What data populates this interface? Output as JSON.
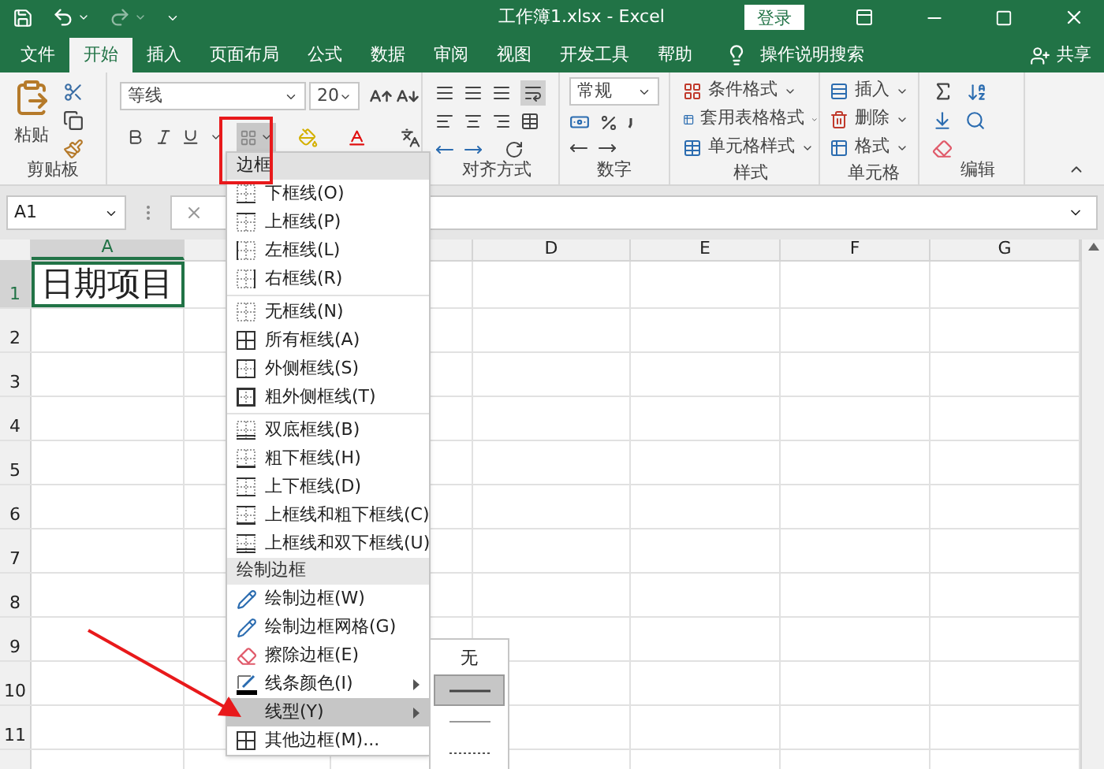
{
  "window": {
    "title": "工作簿1.xlsx - Excel",
    "login_button": "登录"
  },
  "ribbon_tabs": [
    {
      "label": "文件",
      "selected": false
    },
    {
      "label": "开始",
      "selected": true
    },
    {
      "label": "插入",
      "selected": false
    },
    {
      "label": "页面布局",
      "selected": false
    },
    {
      "label": "公式",
      "selected": false
    },
    {
      "label": "数据",
      "selected": false
    },
    {
      "label": "审阅",
      "selected": false
    },
    {
      "label": "视图",
      "selected": false
    },
    {
      "label": "开发工具",
      "selected": false
    },
    {
      "label": "帮助",
      "selected": false
    }
  ],
  "tell_me": "操作说明搜索",
  "share": "共享",
  "ribbon": {
    "clipboard": {
      "paste": "粘贴",
      "group": "剪贴板"
    },
    "font": {
      "name": "等线",
      "size": "20"
    },
    "alignment": {
      "group": "对齐方式"
    },
    "number": {
      "format": "常规",
      "group": "数字"
    },
    "styles": {
      "items": [
        "条件格式",
        "套用表格格式",
        "单元格样式"
      ],
      "group": "样式"
    },
    "cells": {
      "items": [
        "插入",
        "删除",
        "格式"
      ],
      "group": "单元格"
    },
    "editing": {
      "group": "编辑"
    }
  },
  "formula_bar": {
    "name_box": "A1"
  },
  "sheet": {
    "columns": [
      {
        "label": "A",
        "selected": true
      },
      {
        "label": "D",
        "selected": false
      },
      {
        "label": "E",
        "selected": false
      },
      {
        "label": "F",
        "selected": false
      },
      {
        "label": "G",
        "selected": false
      }
    ],
    "rows": [
      {
        "label": "1",
        "selected": true
      },
      {
        "label": "2",
        "selected": false
      },
      {
        "label": "3",
        "selected": false
      },
      {
        "label": "4",
        "selected": false
      },
      {
        "label": "5",
        "selected": false
      },
      {
        "label": "6",
        "selected": false
      },
      {
        "label": "7",
        "selected": false
      },
      {
        "label": "8",
        "selected": false
      },
      {
        "label": "9",
        "selected": false
      },
      {
        "label": "10",
        "selected": false
      },
      {
        "label": "11",
        "selected": false
      }
    ],
    "cell_a1": "日期项目"
  },
  "border_menu": {
    "title": "边框",
    "sections": [
      {
        "items": [
          {
            "label": "下框线(O)",
            "selected": false,
            "submenu": false
          },
          {
            "label": "上框线(P)",
            "selected": false,
            "submenu": false
          },
          {
            "label": "左框线(L)",
            "selected": false,
            "submenu": false
          },
          {
            "label": "右框线(R)",
            "selected": false,
            "submenu": false
          }
        ]
      },
      {
        "items": [
          {
            "label": "无框线(N)",
            "selected": false,
            "submenu": false
          },
          {
            "label": "所有框线(A)",
            "selected": false,
            "submenu": false
          },
          {
            "label": "外侧框线(S)",
            "selected": false,
            "submenu": false
          },
          {
            "label": "粗外侧框线(T)",
            "selected": false,
            "submenu": false
          }
        ]
      },
      {
        "items": [
          {
            "label": "双底框线(B)",
            "selected": false,
            "submenu": false
          },
          {
            "label": "粗下框线(H)",
            "selected": false,
            "submenu": false
          },
          {
            "label": "上下框线(D)",
            "selected": false,
            "submenu": false
          },
          {
            "label": "上框线和粗下框线(C)",
            "selected": false,
            "submenu": false
          },
          {
            "label": "上框线和双下框线(U)",
            "selected": false,
            "submenu": false
          }
        ]
      },
      {
        "header": "绘制边框",
        "items": [
          {
            "label": "绘制边框(W)",
            "selected": false,
            "submenu": false
          },
          {
            "label": "绘制边框网格(G)",
            "selected": false,
            "submenu": false
          },
          {
            "label": "擦除边框(E)",
            "selected": false,
            "submenu": false
          },
          {
            "label": "线条颜色(I)",
            "selected": false,
            "submenu": true
          },
          {
            "label": "线型(Y)",
            "selected": true,
            "submenu": true
          },
          {
            "label": "其他边框(M)...",
            "selected": false,
            "submenu": false
          }
        ]
      }
    ]
  },
  "line_style_menu": [
    {
      "kind": "none",
      "label": "无",
      "selected": false
    },
    {
      "kind": "solid",
      "selected": true
    },
    {
      "kind": "thin",
      "selected": false
    },
    {
      "kind": "dotted",
      "selected": false
    }
  ]
}
